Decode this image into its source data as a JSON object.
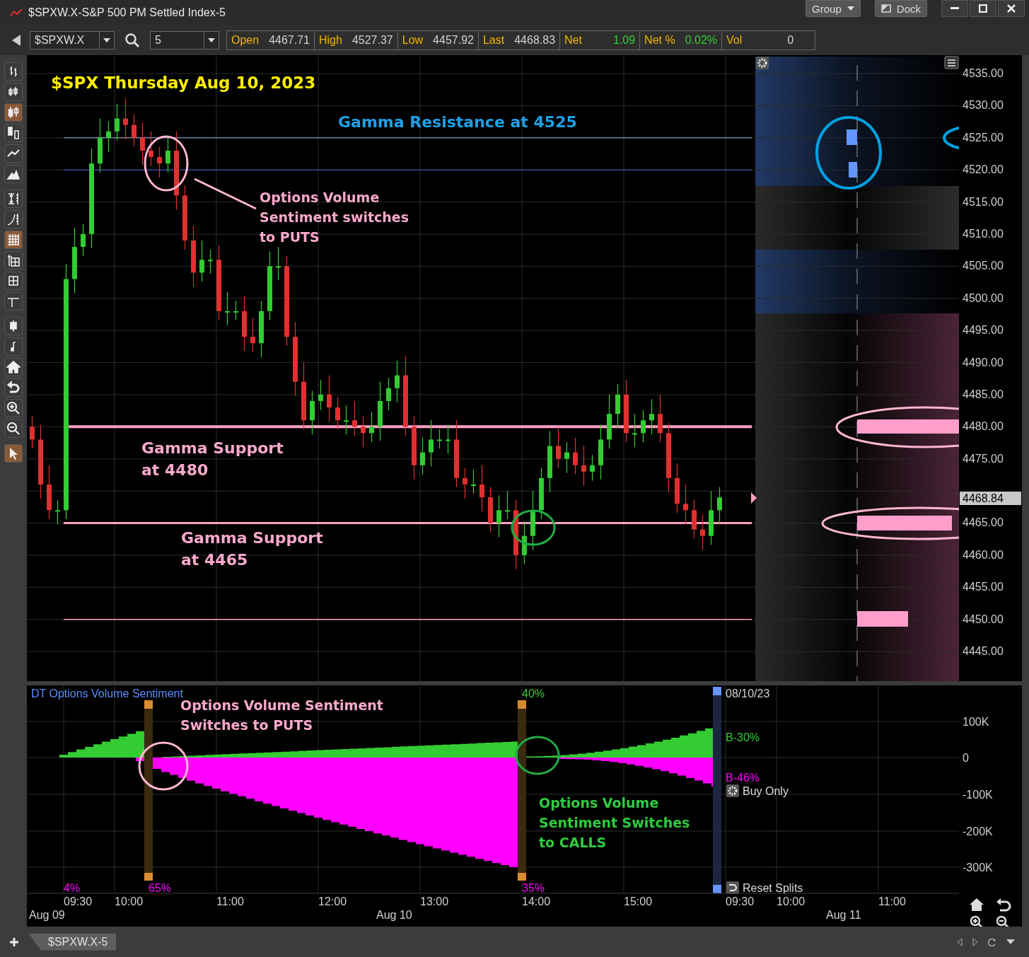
{
  "window": {
    "title": "$SPXW.X-S&P 500 PM Settled Index-5",
    "buttons": [
      {
        "label": "Group",
        "kind": "dropdown"
      },
      {
        "label": "Dock",
        "kind": "dock"
      }
    ]
  },
  "toolbar": {
    "symbol": "$SPXW.X",
    "interval": "5",
    "quotes": [
      {
        "label": "Open",
        "value": "4467.71",
        "kind": "plain"
      },
      {
        "label": "High",
        "value": "4527.37",
        "kind": "plain"
      },
      {
        "label": "Low",
        "value": "4457.92",
        "kind": "plain"
      },
      {
        "label": "Last",
        "value": "4468.83",
        "kind": "plain"
      },
      {
        "label": "Net",
        "value": "1.09",
        "kind": "change"
      },
      {
        "label": "Net %",
        "value": "0.02%",
        "kind": "change"
      },
      {
        "label": "Vol",
        "value": "0",
        "kind": "plain"
      }
    ]
  },
  "tools": [
    {
      "kind": "bars",
      "selected": false
    },
    {
      "kind": "bars2",
      "selected": false
    },
    {
      "kind": "candles",
      "selected": true
    },
    {
      "kind": "hollow",
      "selected": false
    },
    {
      "kind": "line",
      "selected": false
    },
    {
      "kind": "mountain",
      "selected": false
    },
    {
      "kind": "fit",
      "selected": false
    },
    {
      "kind": "log",
      "selected": false
    },
    {
      "kind": "grid",
      "selected": true
    },
    {
      "kind": "table",
      "selected": false
    },
    {
      "kind": "smallgrid",
      "selected": false
    },
    {
      "kind": "crosshair",
      "selected": false
    },
    {
      "kind": "wide",
      "selected": false
    },
    {
      "kind": "narrow",
      "selected": false
    },
    {
      "kind": "home",
      "selected": false
    },
    {
      "kind": "undo",
      "selected": false
    },
    {
      "kind": "zoomin",
      "selected": false
    },
    {
      "kind": "zoomout",
      "selected": false
    },
    {
      "kind": "pointer",
      "selected": true
    }
  ],
  "price_chart": {
    "title": "$SPX Thursday Aug 10, 2023",
    "price_labels": [
      "4535.00",
      "4530.00",
      "4525.00",
      "4520.00",
      "4515.00",
      "4510.00",
      "4505.00",
      "4500.00",
      "4495.00",
      "4490.00",
      "4485.00",
      "4480.00",
      "4475.00",
      "4465.00",
      "4460.00",
      "4455.00",
      "4450.00",
      "4445.00"
    ],
    "last_price": "4468.84",
    "annotations": [
      {
        "kind": "resistance",
        "lines": [
          "Gamma Resistance at 4525"
        ]
      },
      {
        "kind": "puts",
        "lines": [
          "Options Volume",
          "Sentiment switches",
          "to PUTS"
        ]
      },
      {
        "kind": "support",
        "lines": [
          "Gamma Support",
          "at 4480"
        ]
      },
      {
        "kind": "support",
        "lines": [
          "Gamma Support",
          "at 4465"
        ]
      }
    ]
  },
  "sentiment_pane": {
    "title": "DT Options Volume Sentiment",
    "split_labels": [
      {
        "text": "40%",
        "kind": "buy"
      },
      {
        "text": "4%",
        "kind": "sell"
      },
      {
        "text": "65%",
        "kind": "sell"
      },
      {
        "text": "35%",
        "kind": "sell"
      }
    ],
    "date": "08/10/23",
    "buy_label": "B-30%",
    "sell_label": "B-46%",
    "mode": "Buy Only",
    "reset": "Reset Splits",
    "axis_labels": [
      "100K",
      "0",
      "-100K",
      "-200K",
      "-300K"
    ],
    "annotations": [
      {
        "kind": "puts",
        "lines": [
          "Options Volume Sentiment",
          "Switches to PUTS"
        ]
      },
      {
        "kind": "calls",
        "lines": [
          "Options Volume",
          "Sentiment Switches",
          "to CALLS"
        ]
      }
    ]
  },
  "time_axis": {
    "times": [
      "09:30",
      "10:00",
      "11:00",
      "12:00",
      "13:00",
      "14:00",
      "15:00",
      "09:30",
      "10:00",
      "11:00"
    ],
    "dates": [
      "Aug 09",
      "Aug 10",
      "Aug 11"
    ]
  },
  "tabs": [
    {
      "label": "$SPXW.X-5",
      "selected": true
    }
  ]
}
